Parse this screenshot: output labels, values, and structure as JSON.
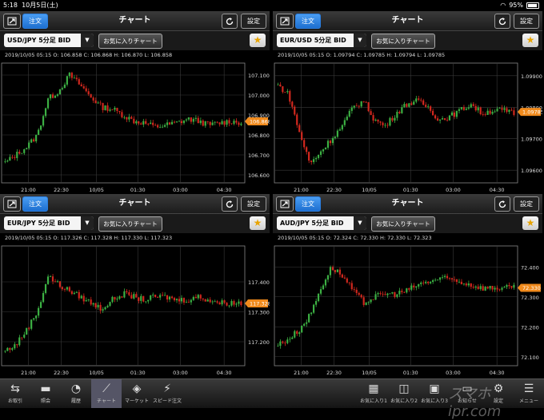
{
  "status": {
    "time": "5:18",
    "date": "10月5日(土)",
    "battery": "95%"
  },
  "common": {
    "order_label": "注文",
    "title": "チャート",
    "settings_label": "設定",
    "favorite_chart_label": "お気に入りチャート"
  },
  "panels": [
    {
      "symbol": "USD/JPY 5分足 BID",
      "info": "2019/10/05 05:15 O: 106.858 C: 106.868 H: 106.870 L: 106.858",
      "price_tag": "106.868",
      "y_ticks": [
        "107.100",
        "107.000",
        "106.900",
        "106.800",
        "106.700",
        "106.600"
      ],
      "x_ticks": [
        "21:00",
        "22:30",
        "10/05",
        "01:30",
        "03:00",
        "04:30"
      ],
      "chart_data": {
        "type": "candlestick",
        "ylim": [
          106.56,
          107.16
        ],
        "close_path": [
          106.66,
          106.7,
          106.74,
          106.8,
          106.98,
          107.02,
          107.1,
          107.05,
          106.99,
          106.94,
          106.93,
          106.9,
          106.87,
          106.86,
          106.84,
          106.85,
          106.86,
          106.88,
          106.87,
          106.85,
          106.86,
          106.87,
          106.86
        ]
      }
    },
    {
      "symbol": "EUR/USD 5分足 BID",
      "info": "2019/10/05 05:15 O: 1.09794 C: 1.09785 H: 1.09794 L: 1.09785",
      "price_tag": "1.09785",
      "y_ticks": [
        "1.09900",
        "1.09800",
        "1.09700",
        "1.09600"
      ],
      "x_ticks": [
        "21:00",
        "22:30",
        "10/05",
        "01:30",
        "03:00",
        "04:30"
      ],
      "chart_data": {
        "type": "candlestick",
        "ylim": [
          1.0956,
          1.0994
        ],
        "close_path": [
          1.0987,
          1.0984,
          1.0972,
          1.0962,
          1.0966,
          1.097,
          1.0974,
          1.098,
          1.0982,
          1.0976,
          1.0974,
          1.0978,
          1.0981,
          1.0982,
          1.098,
          1.0976,
          1.0977,
          1.0979,
          1.0981,
          1.0978,
          1.0979,
          1.0979,
          1.0978
        ]
      }
    },
    {
      "symbol": "EUR/JPY 5分足 BID",
      "info": "2019/10/05 05:15 O: 117.326 C: 117.328 H: 117.330 L: 117.323",
      "price_tag": "117.328",
      "y_ticks": [
        "117.400",
        "117.300",
        "117.200"
      ],
      "x_ticks": [
        "21:00",
        "22:30",
        "10/05",
        "01:30",
        "03:00",
        "04:30"
      ],
      "chart_data": {
        "type": "candlestick",
        "ylim": [
          117.12,
          117.52
        ],
        "close_path": [
          117.17,
          117.19,
          117.24,
          117.3,
          117.42,
          117.39,
          117.37,
          117.35,
          117.33,
          117.31,
          117.34,
          117.36,
          117.35,
          117.34,
          117.35,
          117.35,
          117.34,
          117.34,
          117.35,
          117.34,
          117.33,
          117.33,
          117.33
        ]
      }
    },
    {
      "symbol": "AUD/JPY 5分足 BID",
      "info": "2019/10/05 05:15 O: 72.324 C: 72.330 H: 72.330 L: 72.323",
      "price_tag": "72.330",
      "y_ticks": [
        "72.400",
        "72.300",
        "72.200",
        "72.100"
      ],
      "x_ticks": [
        "21:00",
        "22:30",
        "10/05",
        "01:30",
        "03:00",
        "04:30"
      ],
      "chart_data": {
        "type": "candlestick",
        "ylim": [
          72.07,
          72.47
        ],
        "close_path": [
          72.14,
          72.16,
          72.19,
          72.24,
          72.33,
          72.4,
          72.37,
          72.32,
          72.28,
          72.3,
          72.31,
          72.31,
          72.32,
          72.34,
          72.35,
          72.36,
          72.36,
          72.35,
          72.34,
          72.33,
          72.33,
          72.33,
          72.33
        ]
      }
    }
  ],
  "tabs": [
    {
      "label": "お取引",
      "icon": "arrows-icon"
    },
    {
      "label": "照会",
      "icon": "folder-icon"
    },
    {
      "label": "履歴",
      "icon": "history-icon"
    },
    {
      "label": "チャート",
      "icon": "chart-icon",
      "active": true
    },
    {
      "label": "マーケット",
      "icon": "market-icon"
    },
    {
      "label": "スピード注文",
      "icon": "speed-order-icon"
    },
    {
      "label": "お気に入り1",
      "icon": "grid4-icon"
    },
    {
      "label": "お気に入り2",
      "icon": "grid2-icon"
    },
    {
      "label": "お気に入り3",
      "icon": "window-icon"
    },
    {
      "label": "お知らせ",
      "icon": "notice-icon"
    },
    {
      "label": "設定",
      "icon": "gear-icon"
    },
    {
      "label": "メニュー",
      "icon": "menu-icon"
    }
  ],
  "watermark": "スマホ ipr.com",
  "colors": {
    "up": "#3cb043",
    "down": "#d2281e",
    "accent": "#1d6fd0",
    "tag": "#f08a1c",
    "grid": "#3a3a3a"
  }
}
